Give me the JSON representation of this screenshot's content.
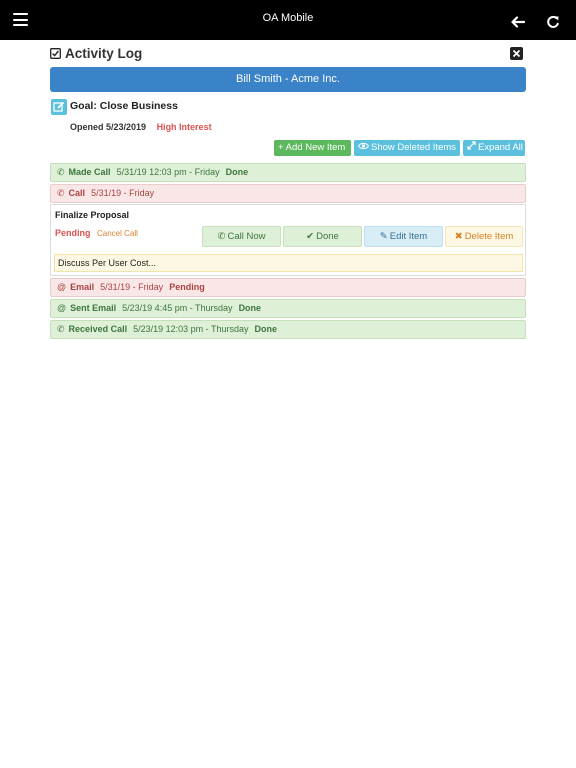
{
  "topbar": {
    "title": "OA Mobile"
  },
  "header": {
    "title": "Activity Log"
  },
  "contact": {
    "label": "Bill Smith - Acme Inc."
  },
  "goal": {
    "label": "Goal: Close Business",
    "opened": "Opened 5/23/2019",
    "interest": "High Interest"
  },
  "toolbar": {
    "add_label": "+ Add New Item",
    "show_deleted_label": "Show Deleted Items",
    "expand_all_label": "Expand All"
  },
  "activities": [
    {
      "name": "Made Call",
      "when": "5/31/19 12:03 pm - Friday",
      "status": "Done",
      "icon": "phone-icon"
    },
    {
      "name": "Call",
      "when": "5/31/19 - Friday",
      "status": "",
      "icon": "phone-icon"
    },
    {
      "name": "Email",
      "when": "5/31/19 - Friday",
      "status": "Pending",
      "icon": "at-icon",
      "symbol": "@"
    },
    {
      "name": "Sent Email",
      "when": "5/23/19 4:45 pm - Thursday",
      "status": "Done",
      "icon": "at-icon",
      "symbol": "@"
    },
    {
      "name": "Received Call",
      "when": "5/23/19 12:03 pm - Thursday",
      "status": "Done",
      "icon": "phone-icon"
    }
  ],
  "expanded_item": {
    "title": "Finalize Proposal",
    "status": "Pending",
    "cancel_label": "Cancel Call",
    "buttons": {
      "call_now": "Call Now",
      "done": "Done",
      "edit": "Edit Item",
      "delete": "Delete Item"
    },
    "note": "Discuss Per User Cost..."
  },
  "colors": {
    "topbar": "#000000",
    "accent_blue": "#3b83c8",
    "success": "#5cb85c",
    "info": "#5bc0de",
    "danger": "#d9534f"
  }
}
